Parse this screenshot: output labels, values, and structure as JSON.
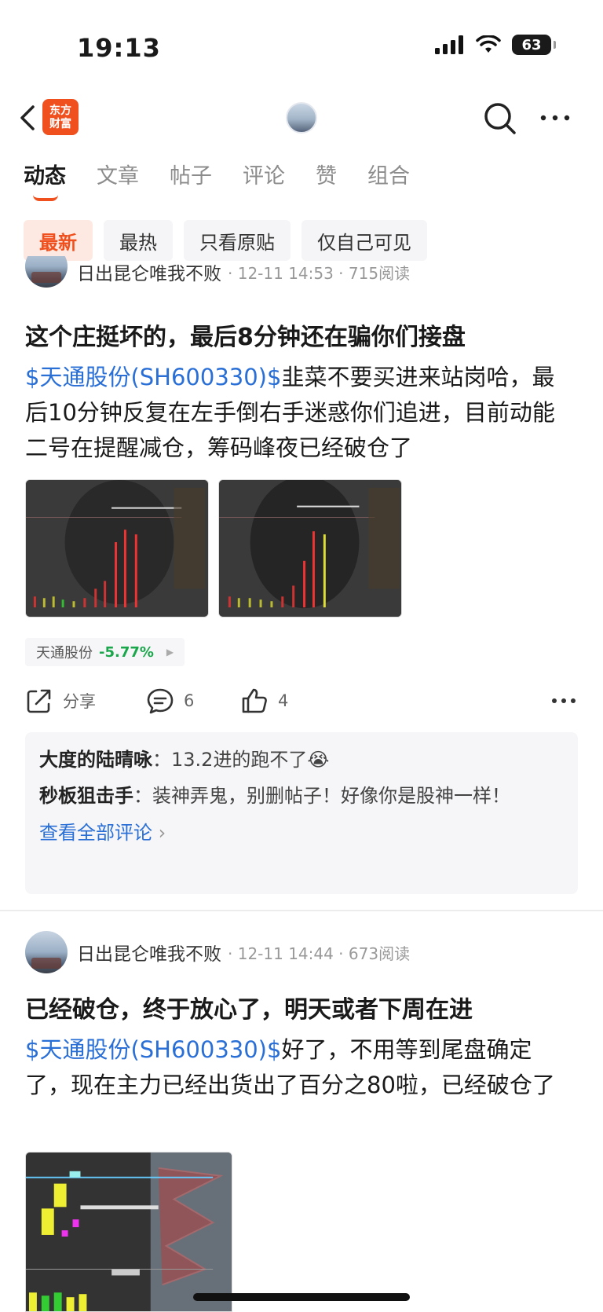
{
  "status_bar": {
    "time": "19:13",
    "battery": "63"
  },
  "nav": {
    "app_logo_line1": "东方",
    "app_logo_line2": "财富"
  },
  "tabs": [
    {
      "label": "动态"
    },
    {
      "label": "文章"
    },
    {
      "label": "帖子"
    },
    {
      "label": "评论"
    },
    {
      "label": "赞"
    },
    {
      "label": "组合"
    }
  ],
  "chips": [
    {
      "label": "最新"
    },
    {
      "label": "最热"
    },
    {
      "label": "只看原贴"
    },
    {
      "label": "仅自己可见"
    }
  ],
  "posts": [
    {
      "author": "日出昆仑唯我不败",
      "meta": "· 12-11 14:53 · 715阅读",
      "title": "这个庄挺坏的，最后8分钟还在骗你们接盘",
      "stock_link": "$天通股份(SH600330)$",
      "body": "韭菜不要买进来站岗哈，最后10分钟反复在左手倒右手迷惑你们追进，目前动能二号在提醒减仓，筹码峰夜已经破仓了",
      "stock_chip": {
        "name": "天通股份",
        "change": "-5.77%"
      },
      "actions": {
        "share": "分享",
        "comments": "6",
        "likes": "4"
      },
      "comments": [
        {
          "name": "大度的陆晴咏",
          "text": "13.2进的跑不了😭"
        },
        {
          "name": "秒板狙击手",
          "text": "装神弄鬼，别删帖子！好像你是股神一样！"
        }
      ],
      "view_all": "查看全部评论"
    },
    {
      "author": "日出昆仑唯我不败",
      "meta": "· 12-11 14:44 · 673阅读",
      "title": "已经破仓，终于放心了，明天或者下周在进",
      "stock_link": "$天通股份(SH600330)$",
      "body": "好了，不用等到尾盘确定了，现在主力已经出货出了百分之80啦，已经破仓了"
    }
  ],
  "colors": {
    "accent": "#f0501e",
    "link": "#2a6fd6",
    "down": "#1aa64b"
  }
}
